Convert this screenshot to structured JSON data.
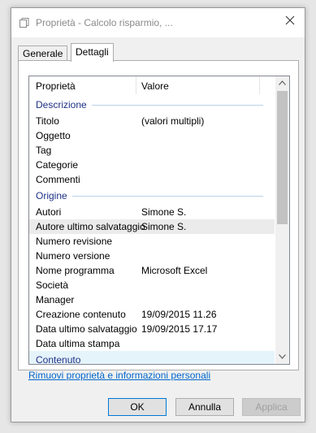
{
  "window": {
    "title": "Proprietà - Calcolo risparmio, ..."
  },
  "tabs": [
    {
      "label": "Generale"
    },
    {
      "label": "Dettagli"
    }
  ],
  "table": {
    "headers": {
      "property": "Proprietà",
      "value": "Valore"
    },
    "groups": {
      "descrizione": "Descrizione",
      "origine": "Origine",
      "contenuto": "Contenuto"
    },
    "rows": {
      "titolo": {
        "k": "Titolo",
        "v": "(valori multipli)"
      },
      "oggetto": {
        "k": "Oggetto",
        "v": ""
      },
      "tag": {
        "k": "Tag",
        "v": ""
      },
      "categorie": {
        "k": "Categorie",
        "v": ""
      },
      "commenti": {
        "k": "Commenti",
        "v": ""
      },
      "autori": {
        "k": "Autori",
        "v": "Simone S."
      },
      "autore_ultimo": {
        "k": "Autore ultimo salvataggio",
        "v": "Simone S."
      },
      "numero_revisione": {
        "k": "Numero revisione",
        "v": ""
      },
      "numero_versione": {
        "k": "Numero versione",
        "v": ""
      },
      "nome_programma": {
        "k": "Nome programma",
        "v": "Microsoft Excel"
      },
      "societa": {
        "k": "Società",
        "v": ""
      },
      "manager": {
        "k": "Manager",
        "v": ""
      },
      "creazione": {
        "k": "Creazione contenuto",
        "v": "19/09/2015 11.26"
      },
      "data_ultimo": {
        "k": "Data ultimo salvataggio",
        "v": "19/09/2015 17.17"
      },
      "data_stampa": {
        "k": "Data ultima stampa",
        "v": ""
      }
    }
  },
  "link": {
    "remove": "Rimuovi proprietà e informazioni personali"
  },
  "buttons": {
    "ok": "OK",
    "cancel": "Annulla",
    "apply": "Applica"
  },
  "colors": {
    "group_header": "#1e3287",
    "link": "#0066cc",
    "default_button_border": "#0078d7"
  }
}
